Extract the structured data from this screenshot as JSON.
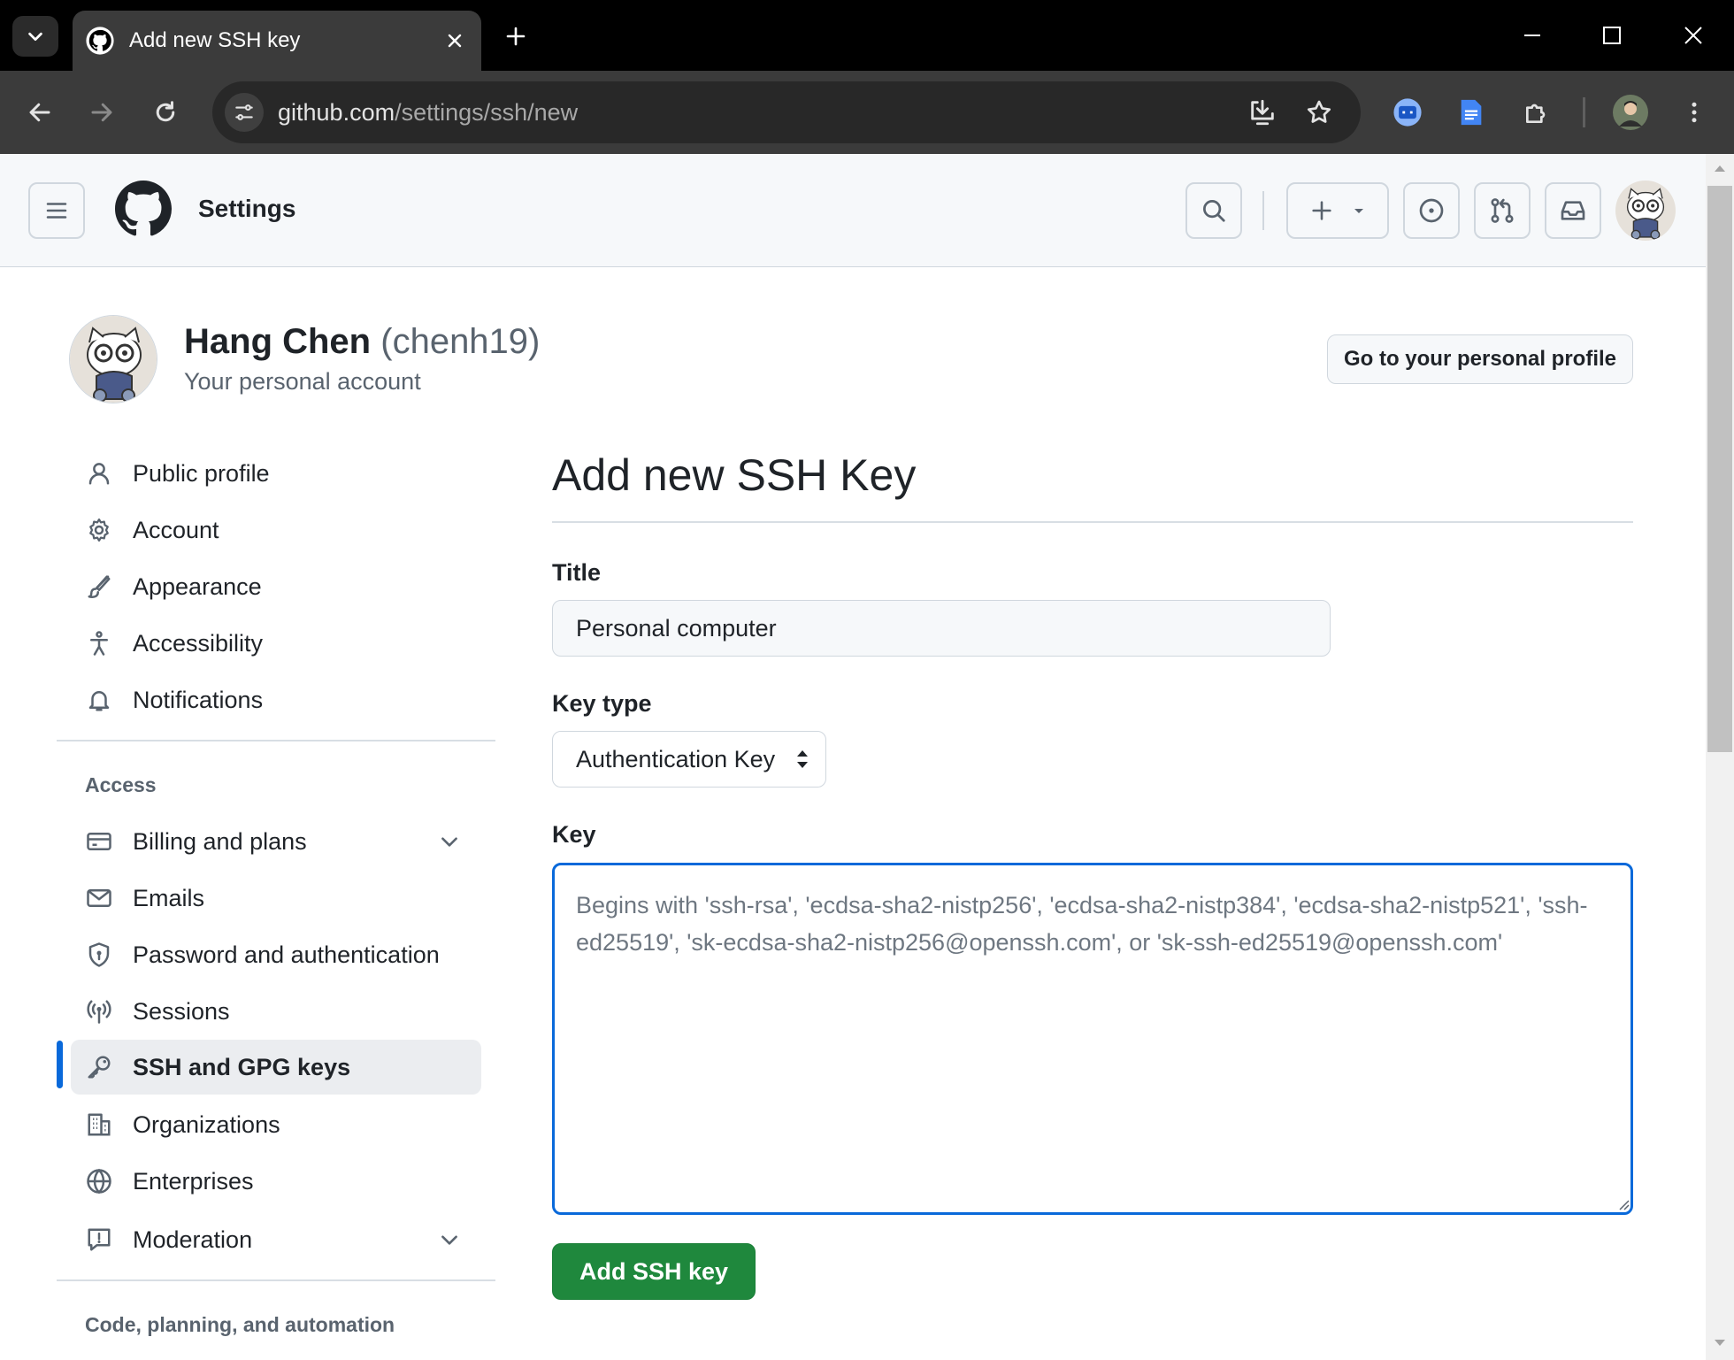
{
  "browser": {
    "tab_title": "Add new SSH key",
    "url_host": "github.com",
    "url_path": "/settings/ssh/new"
  },
  "header": {
    "title": "Settings"
  },
  "profile": {
    "name": "Hang Chen",
    "login": "(chenh19)",
    "subtitle": "Your personal account",
    "profile_button": "Go to your personal profile"
  },
  "sidebar": {
    "items": [
      {
        "label": "Public profile",
        "icon": "person-icon"
      },
      {
        "label": "Account",
        "icon": "gear-icon"
      },
      {
        "label": "Appearance",
        "icon": "paintbrush-icon"
      },
      {
        "label": "Accessibility",
        "icon": "accessibility-icon"
      },
      {
        "label": "Notifications",
        "icon": "bell-icon"
      }
    ],
    "access_heading": "Access",
    "access_items": [
      {
        "label": "Billing and plans",
        "icon": "credit-card-icon"
      },
      {
        "label": "Emails",
        "icon": "mail-icon"
      },
      {
        "label": "Password and authentication",
        "icon": "shield-lock-icon"
      },
      {
        "label": "Sessions",
        "icon": "broadcast-icon"
      },
      {
        "label": "SSH and GPG keys",
        "icon": "key-icon"
      },
      {
        "label": "Organizations",
        "icon": "organization-icon"
      },
      {
        "label": "Enterprises",
        "icon": "globe-icon"
      },
      {
        "label": "Moderation",
        "icon": "report-icon"
      }
    ],
    "code_heading": "Code, planning, and automation"
  },
  "form": {
    "heading": "Add new SSH Key",
    "title_label": "Title",
    "title_value": "Personal computer",
    "keytype_label": "Key type",
    "keytype_value": "Authentication Key",
    "key_label": "Key",
    "key_placeholder": "Begins with 'ssh-rsa', 'ecdsa-sha2-nistp256', 'ecdsa-sha2-nistp384', 'ecdsa-sha2-nistp521', 'ssh-ed25519', 'sk-ecdsa-sha2-nistp256@openssh.com', or 'sk-ssh-ed25519@openssh.com'",
    "submit_label": "Add SSH key"
  },
  "colors": {
    "accent_blue": "#0969da",
    "primary_green": "#1f883d"
  }
}
